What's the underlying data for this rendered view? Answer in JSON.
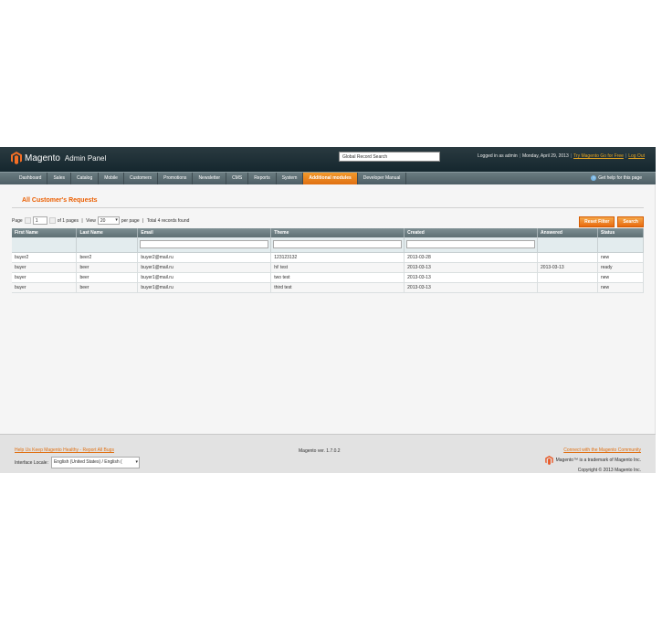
{
  "header": {
    "brand": "Magento",
    "brand_sub": "Admin Panel",
    "global_search_value": "Global Record Search",
    "logged_in": "Logged in as admin",
    "date": "Monday, April 29, 2013",
    "try_link": "Try Magento Go for Free",
    "logout": "Log Out"
  },
  "nav": {
    "items": [
      "Dashboard",
      "Sales",
      "Catalog",
      "Mobile",
      "Customers",
      "Promotions",
      "Newsletter",
      "CMS",
      "Reports",
      "System",
      "Additional modules",
      "Developer Manual"
    ],
    "help": "Get help for this page"
  },
  "page": {
    "title": "All Customer's Requests",
    "pager": {
      "page_label": "Page",
      "page_value": "1",
      "of_pages": "of 1 pages",
      "view_label": "View",
      "view_value": "20",
      "per_page": "per page",
      "total": "Total 4 records found"
    },
    "buttons": {
      "reset": "Reset Filter",
      "search": "Search"
    }
  },
  "grid": {
    "columns": [
      "First Name",
      "Last Name",
      "Email",
      "Theme",
      "Created",
      "Answered",
      "Status"
    ],
    "rows": [
      [
        "buyer2",
        "beer2",
        "buyer2@mail.ru",
        "123123132",
        "2013-03-28",
        "",
        "new"
      ],
      [
        "buyer",
        "beer",
        "buyer1@mail.ru",
        "hi! test",
        "2013-03-13",
        "2013-03-13",
        "ready"
      ],
      [
        "buyer",
        "beer",
        "buyer1@mail.ru",
        "two test",
        "2013-03-13",
        "",
        "new"
      ],
      [
        "buyer",
        "beer",
        "buyer1@mail.ru",
        "third test",
        "2013-03-13",
        "",
        "new"
      ]
    ]
  },
  "footer": {
    "bug_link": "Help Us Keep Magento Healthy - Report All Bugs",
    "locale_label": "Interface Locale:",
    "locale_value": "English (United States) / English (",
    "version": "Magento ver. 1.7.0.2",
    "community_link": "Connect with the Magento Community",
    "trademark": "Magento™ is a trademark of Magento Inc.",
    "copyright": "Copyright © 2013 Magento Inc."
  },
  "colors": {
    "accent": "#e07012",
    "header": "#15272e",
    "title": "#eb5e00"
  }
}
